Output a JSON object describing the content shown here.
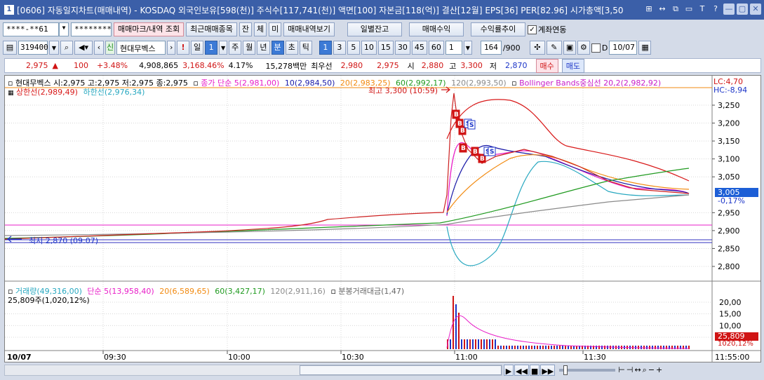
{
  "window": {
    "number": "1",
    "title": "[0606] 자동일지차트(매매내역) - KOSDAQ 외국인보유[598(천)] 주식수[117,741(천)] 액면[100] 자본금[118(억)] 결산[12월] EPS[36] PER[82.96] 시가총액[3,50",
    "icons": [
      "expand-icon",
      "link-icon",
      "copy-icon",
      "minimize-icon",
      "pin-icon",
      "help-icon",
      "minimize-window-icon",
      "restore-window-icon",
      "close-icon"
    ],
    "icon_glyphs": [
      "⊞",
      "↔",
      "⧉",
      "▭",
      "T",
      "?",
      "—",
      "▢",
      "✕"
    ]
  },
  "toolbar": {
    "account": "****-**61",
    "password": "********",
    "trade_mark_label": "매매마크/내역 조회",
    "recent_trades_label": "최근매매종목",
    "btn_jan": "잔",
    "btn_che": "체",
    "btn_mi": "미",
    "trade_view_label": "매매내역보기",
    "daily_balance_label": "일별잔고",
    "trade_profit_label": "매매수익",
    "profit_trend_label": "수익률추이",
    "account_link_label": "계좌연동",
    "account_link_checked": true
  },
  "toolbar2": {
    "stock_code": "319400",
    "new_badge": "신",
    "stock_name": "현대무벡스",
    "exclam": "!",
    "period_il": "일",
    "period_num": "1",
    "period_ju": "주",
    "period_wol": "월",
    "period_nyeon": "년",
    "period_bun": "분",
    "period_cho": "초",
    "period_tick": "틱",
    "intervals": [
      "1",
      "3",
      "5",
      "10",
      "15",
      "30",
      "45",
      "60"
    ],
    "selected_interval": "1",
    "interval_select": "1",
    "count": "164",
    "count_total": "/900",
    "date_label": "D",
    "date_value": "10/07"
  },
  "quote": {
    "price": "2,975",
    "change_arrow": "▲",
    "change": "100",
    "change_pct": "+3.48%",
    "volume": "4,908,865",
    "volume_ratio": "3,168.46%",
    "turnover": "4.17%",
    "amount": "15,278백만",
    "best_ask_label": "최우선",
    "best_ask": "2,980",
    "best_bid": "2,975",
    "open_label": "시",
    "open": "2,880",
    "high_label": "고",
    "high": "3,300",
    "low_label": "저",
    "low": "2,870",
    "buy_label": "매수",
    "sell_label": "매도"
  },
  "price_legend": {
    "name_ohlc": "현대무벡스 시:2,975 고:2,975 저:2,975 종:2,975",
    "ma_close": "종가 단순 5(2,981,00)",
    "ma10": "10(2,984,50)",
    "ma20": "20(2,983,25)",
    "ma60": "60(2,992,17)",
    "ma120": "120(2,993,50)",
    "bollinger": "Bollinger Bands중심선 20,2(2,982,92)",
    "upper_band": "상한선(2,989,49)",
    "lower_band": "하한선(2,976,34)",
    "high_marker": "최고 3,300 (10:59)",
    "low_marker": "최저 2,870 (09:07)",
    "lc": "LC:4,70",
    "hc": "HC:-8,94",
    "current_price_box": "3,005",
    "current_pct": "-0,17%"
  },
  "volume_legend": {
    "volume": "거래량(49,316,00)",
    "ma5": "단순 5(13,958,40)",
    "ma20": "20(6,589,65)",
    "ma60": "60(3,427,17)",
    "ma120": "120(2,911,16)",
    "amount": "분봉거래대금(1,47)",
    "shares": "25,809주(1,020,12%)",
    "vol_box": "25,809",
    "vol_pct": "1020,12%"
  },
  "price_axis": [
    "3,250",
    "3,200",
    "3,150",
    "3,100",
    "3,050",
    "2,950",
    "2,900",
    "2,850",
    "2,800"
  ],
  "volume_axis": [
    "20,00",
    "15,00",
    "10,00",
    "5,00"
  ],
  "time_axis": {
    "date": "10/07",
    "ticks": [
      "09:30",
      "10:00",
      "10:30",
      "11:00",
      "11:30"
    ],
    "end_time": "11:55:00"
  },
  "trade_markers": {
    "buy": "B",
    "sell": "S"
  },
  "colors": {
    "title_bg": "#3b5fa8",
    "up": "#d01414",
    "down": "#1c35c8",
    "ma5": "#e81ec8",
    "ma10": "#1a1aa8",
    "ma20": "#f28a10",
    "ma60": "#1f9a1f",
    "ma120": "#8a8a8a",
    "boll_upper": "#d81818",
    "boll_lower": "#28a8c0"
  }
}
